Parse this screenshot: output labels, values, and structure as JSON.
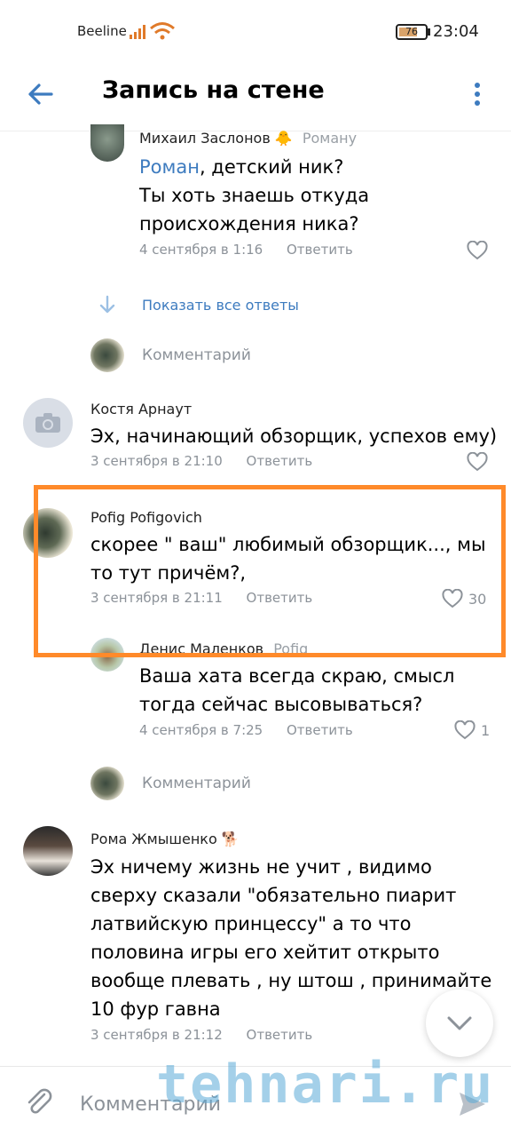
{
  "status_bar": {
    "carrier": "Beeline",
    "battery": "76",
    "time": "23:04"
  },
  "header": {
    "title": "Запись на стене"
  },
  "comments": [
    {
      "author": "Михаил Заслонов",
      "author_emoji": "🐥",
      "reply_to": "Роману",
      "mention": "Роман",
      "lines": [
        ", детский ник?",
        "Ты хоть знаешь откуда",
        "происхождения ника?"
      ],
      "date": "4 сентября в 1:16",
      "reply_label": "Ответить",
      "likes": ""
    },
    {
      "author": "Костя Арнаут",
      "lines": [
        "Эх, начинающий обзорщик, успехов ему)"
      ],
      "date": "3 сентября в 21:10",
      "reply_label": "Ответить",
      "likes": ""
    },
    {
      "author": "Pofig Pofigovich",
      "lines": [
        "скорее \" ваш\" любимый обзорщик..., мы",
        "то тут причём?,"
      ],
      "date": "3 сентября в 21:11",
      "reply_label": "Ответить",
      "likes": "30"
    },
    {
      "author": "Денис Маленков",
      "reply_to": "Pofig",
      "lines": [
        "Ваша хата всегда скраю, смысл",
        "тогда сейчас высовываться?"
      ],
      "date": "4 сентября в 7:25",
      "reply_label": "Ответить",
      "likes": "1"
    },
    {
      "author": "Рома Жмышенко",
      "author_emoji": "🐕",
      "lines": [
        "Эх ничему жизнь не учит , видимо",
        "сверху сказали \"обязательно пиарит",
        "латвийскую принцессу\" а то что",
        "половина игры его хейтит открыто",
        "вообще плевать , ну штош , принимайте",
        "10 фур гавна"
      ],
      "date": "3 сентября в 21:12",
      "reply_label": "Ответить",
      "likes": ""
    }
  ],
  "show_all_replies": "Показать все ответы",
  "comment_prompt": "Комментарий",
  "composer": {
    "placeholder": "Комментарий"
  },
  "watermark": "tehnari.ru",
  "colors": {
    "accent": "#3d7bbf",
    "highlight": "#ff8a2a"
  }
}
